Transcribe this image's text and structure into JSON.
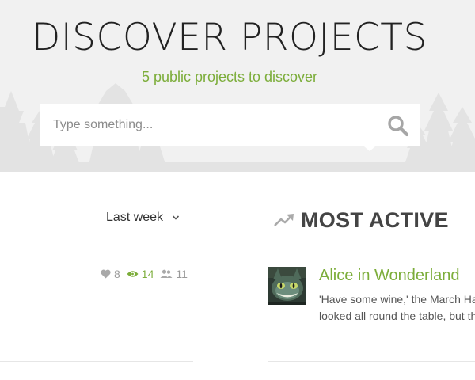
{
  "hero": {
    "title": "DISCOVER PROJECTS",
    "subtitle": "5 public projects to discover",
    "background_color": "#f1f1f1",
    "accent_color": "#7cad3a"
  },
  "search": {
    "placeholder": "Type something...",
    "value": "",
    "icon": "search-icon"
  },
  "filter": {
    "selected": "Last week",
    "icon": "chevron-down-icon"
  },
  "stats": {
    "likes": "8",
    "views": "14",
    "members": "11",
    "icons": [
      "heart-icon",
      "eye-icon",
      "people-icon"
    ]
  },
  "section": {
    "title": "MOST ACTIVE",
    "icon": "trending-up-icon"
  },
  "project": {
    "title": "Alice in Wonderland",
    "excerpt_line1": "'Have some wine,' the March Hare said in an encouraging tone.",
    "excerpt_line2": "looked all round the table, but there was nothing on it but tea."
  }
}
